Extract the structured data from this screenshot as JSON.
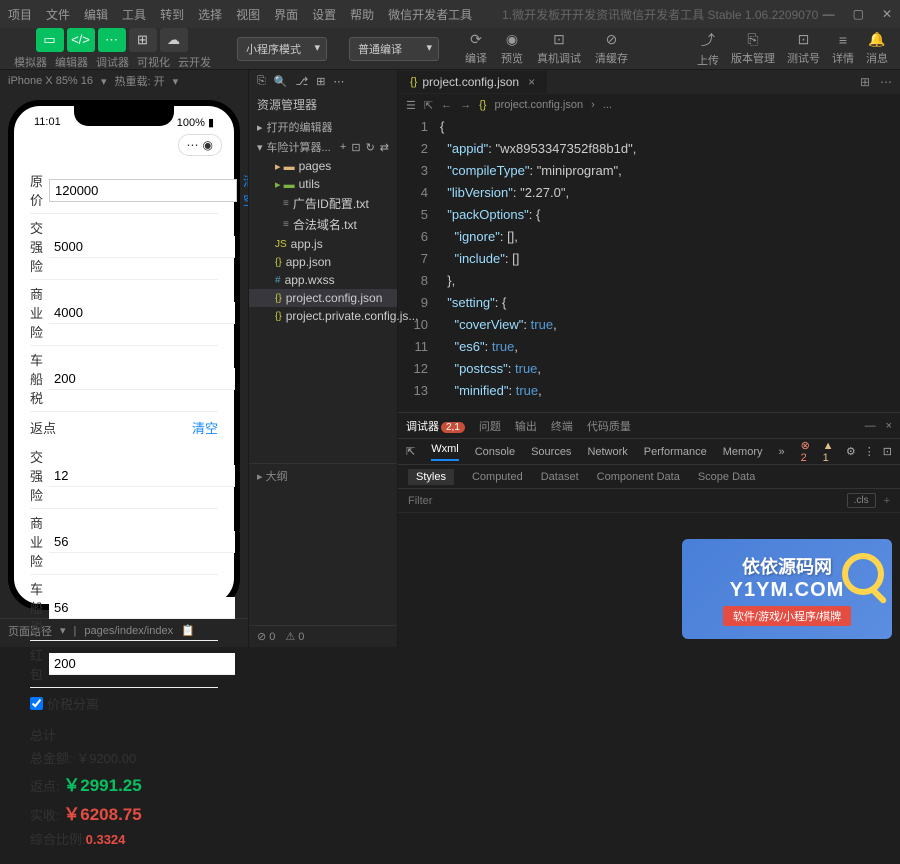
{
  "menu": {
    "items": [
      "项目",
      "文件",
      "编辑",
      "工具",
      "转到",
      "选择",
      "视图",
      "界面",
      "设置",
      "帮助",
      "微信开发者工具"
    ]
  },
  "title": "1.微开发板开开发资讯微信开发者工具 Stable 1.06.2209070",
  "toolbar": {
    "labels": [
      "模拟器",
      "编辑器",
      "调试器",
      "可视化",
      "云开发"
    ],
    "mode": "小程序模式",
    "compile": "普通编译",
    "actions": [
      "编译",
      "预览",
      "真机调试",
      "清缓存"
    ],
    "right": [
      "上传",
      "版本管理",
      "测试号",
      "详情",
      "消息"
    ]
  },
  "sim": {
    "device": "iPhone X 85% 16",
    "hot": "热重载: 开",
    "time": "11:01",
    "battery": "100%",
    "form": {
      "origLabel": "原价",
      "orig": "120000",
      "clear": "清空",
      "jqLabel": "交强险",
      "jq": "5000",
      "syLabel": "商业险",
      "sy": "4000",
      "ccLabel": "车船税",
      "cc": "200",
      "rebateLabel": "返点",
      "jq2": "12",
      "sy2": "56",
      "cc2": "56",
      "hbLabel": "红 包",
      "hb": "200",
      "chk": "价税分离",
      "totalLabel": "总计",
      "totalAmt": "总金额: ￥9200.00",
      "rebate": "返点:",
      "rebateV": "￥2991.25",
      "actual": "实收:",
      "actualV": "￥6208.75",
      "ratio": "综合比例:",
      "ratioV": "0.3324"
    },
    "footer": {
      "path": "页面路径",
      "val": "pages/index/index"
    }
  },
  "explorer": {
    "title": "资源管理器",
    "opened": "打开的编辑器",
    "project": "车险计算器...",
    "items": [
      {
        "n": "pages",
        "t": "folder"
      },
      {
        "n": "utils",
        "t": "folder-green"
      },
      {
        "n": "广告ID配置.txt",
        "t": "txt",
        "nested": 1
      },
      {
        "n": "合法域名.txt",
        "t": "txt",
        "nested": 1
      },
      {
        "n": "app.js",
        "t": "js"
      },
      {
        "n": "app.json",
        "t": "json"
      },
      {
        "n": "app.wxss",
        "t": "wxss"
      },
      {
        "n": "project.config.json",
        "t": "json",
        "sel": 1
      },
      {
        "n": "project.private.config.js...",
        "t": "json"
      }
    ],
    "outline": "大纲"
  },
  "editor": {
    "tab": "project.config.json",
    "breadcrumb": "project.config.json",
    "lines": [
      {
        "n": 1,
        "t": "{"
      },
      {
        "n": 2,
        "t": "  \"appid\": \"wx8953347352f88b1d\","
      },
      {
        "n": 3,
        "t": "  \"compileType\": \"miniprogram\","
      },
      {
        "n": 4,
        "t": "  \"libVersion\": \"2.27.0\","
      },
      {
        "n": 5,
        "t": "  \"packOptions\": {"
      },
      {
        "n": 6,
        "t": "    \"ignore\": [],"
      },
      {
        "n": 7,
        "t": "    \"include\": []"
      },
      {
        "n": 8,
        "t": "  },"
      },
      {
        "n": 9,
        "t": "  \"setting\": {"
      },
      {
        "n": 10,
        "t": "    \"coverView\": true,"
      },
      {
        "n": 11,
        "t": "    \"es6\": true,"
      },
      {
        "n": 12,
        "t": "    \"postcss\": true,"
      },
      {
        "n": 13,
        "t": "    \"minified\": true,"
      }
    ]
  },
  "debug": {
    "tabs": [
      "调试器",
      "问题",
      "输出",
      "终端",
      "代码质量"
    ],
    "badge": "2,1",
    "sub": [
      "Wxml",
      "Console",
      "Sources",
      "Network",
      "Performance",
      "Memory"
    ],
    "errs": "2",
    "warns": "1",
    "sub2": [
      "Styles",
      "Computed",
      "Dataset",
      "Component Data",
      "Scope Data"
    ],
    "filter": "Filter",
    "cls": ".cls"
  },
  "watermark": {
    "title": "依依源码网",
    "url": "Y1YM.COM",
    "sub": "软件/游戏/小程序/棋牌"
  }
}
